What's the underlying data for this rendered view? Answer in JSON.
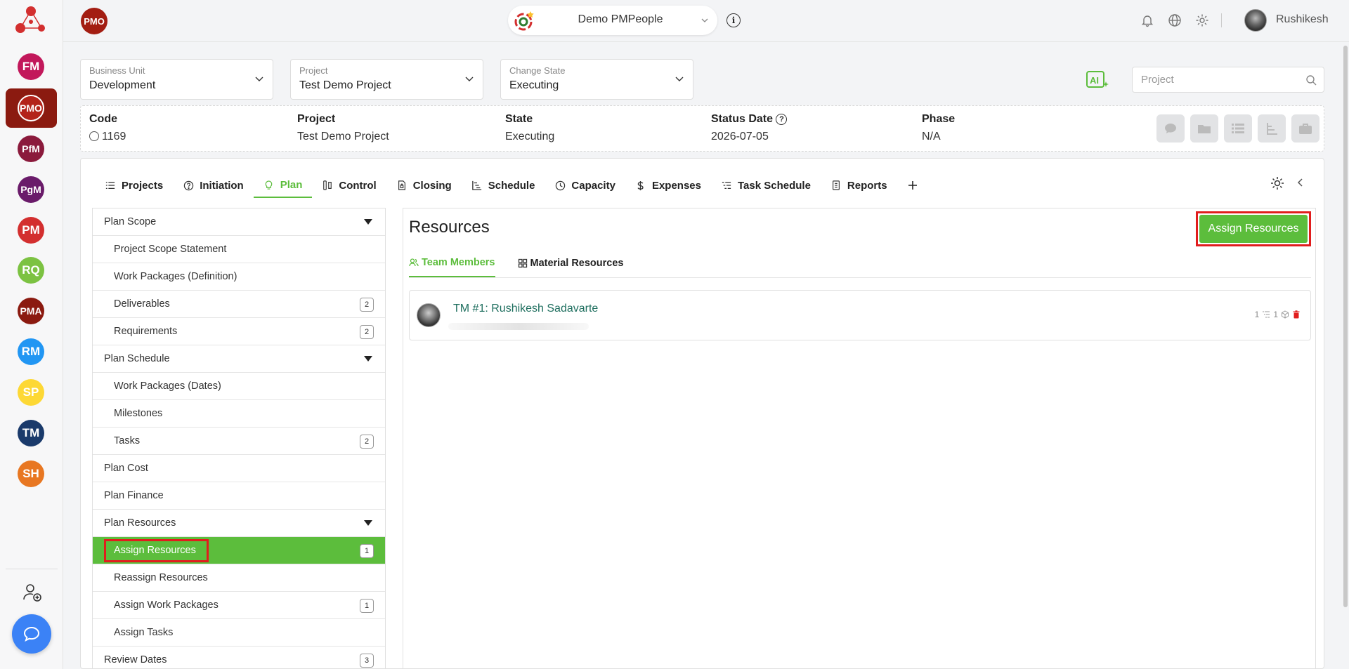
{
  "rail": {
    "items": [
      {
        "label": "FM",
        "color": "#c2185b"
      },
      {
        "label": "PfM",
        "color": "#8b1a3c"
      },
      {
        "label": "PgM",
        "color": "#6a1b6a"
      },
      {
        "label": "PM",
        "color": "#d32f2f"
      },
      {
        "label": "RQ",
        "color": "#7cc242"
      },
      {
        "label": "PMA",
        "color": "#8b1a10"
      },
      {
        "label": "RM",
        "color": "#2196f3"
      },
      {
        "label": "SP",
        "color": "#fdd835"
      },
      {
        "label": "TM",
        "color": "#1a3a6b"
      },
      {
        "label": "SH",
        "color": "#e87722"
      }
    ],
    "active_label": "PMO"
  },
  "topbar": {
    "badge": "PMO",
    "project_name": "Demo PMPeople",
    "user_name": "Rushikesh"
  },
  "filters": {
    "business_unit": {
      "label": "Business Unit",
      "value": "Development"
    },
    "project": {
      "label": "Project",
      "value": "Test Demo Project"
    },
    "change_state": {
      "label": "Change State",
      "value": "Executing"
    },
    "search_placeholder": "Project"
  },
  "info": {
    "code_label": "Code",
    "code_value": "1169",
    "project_label": "Project",
    "project_value": "Test Demo Project",
    "state_label": "State",
    "state_value": "Executing",
    "status_date_label": "Status Date",
    "status_date_value": "2026-07-05",
    "phase_label": "Phase",
    "phase_value": "N/A"
  },
  "tabs": [
    {
      "label": "Projects",
      "icon": "list-icon"
    },
    {
      "label": "Initiation",
      "icon": "question-circle-icon"
    },
    {
      "label": "Plan",
      "icon": "bulb-icon",
      "active": true
    },
    {
      "label": "Control",
      "icon": "columns-icon"
    },
    {
      "label": "Closing",
      "icon": "lock-file-icon"
    },
    {
      "label": "Schedule",
      "icon": "gantt-icon"
    },
    {
      "label": "Capacity",
      "icon": "clock-icon"
    },
    {
      "label": "Expenses",
      "icon": "dollar-icon"
    },
    {
      "label": "Task Schedule",
      "icon": "task-list-icon"
    },
    {
      "label": "Reports",
      "icon": "report-icon"
    }
  ],
  "tree": [
    {
      "label": "Plan Scope",
      "level": 0,
      "caret": true
    },
    {
      "label": "Project Scope Statement",
      "level": 1
    },
    {
      "label": "Work Packages (Definition)",
      "level": 1
    },
    {
      "label": "Deliverables",
      "level": 1,
      "count": "2"
    },
    {
      "label": "Requirements",
      "level": 1,
      "count": "2"
    },
    {
      "label": "Plan Schedule",
      "level": 0,
      "caret": true
    },
    {
      "label": "Work Packages (Dates)",
      "level": 1
    },
    {
      "label": "Milestones",
      "level": 1
    },
    {
      "label": "Tasks",
      "level": 1,
      "count": "2"
    },
    {
      "label": "Plan Cost",
      "level": 0
    },
    {
      "label": "Plan Finance",
      "level": 0
    },
    {
      "label": "Plan Resources",
      "level": 0,
      "caret": true
    },
    {
      "label": "Assign Resources",
      "level": 1,
      "count": "1",
      "active": true
    },
    {
      "label": "Reassign Resources",
      "level": 1
    },
    {
      "label": "Assign Work Packages",
      "level": 1,
      "count": "1"
    },
    {
      "label": "Assign Tasks",
      "level": 1
    },
    {
      "label": "Review Dates",
      "level": 0,
      "count": "3"
    }
  ],
  "resources": {
    "title": "Resources",
    "assign_button": "Assign Resources",
    "subtabs": {
      "team": "Team Members",
      "material": "Material Resources"
    },
    "member": {
      "name": "TM #1: Rushikesh Sadavarte",
      "meta_a": "1",
      "meta_b": "1"
    }
  },
  "colors": {
    "accent": "#5cbd3c",
    "highlight": "#e11d1d",
    "brand": "#a31d12"
  }
}
